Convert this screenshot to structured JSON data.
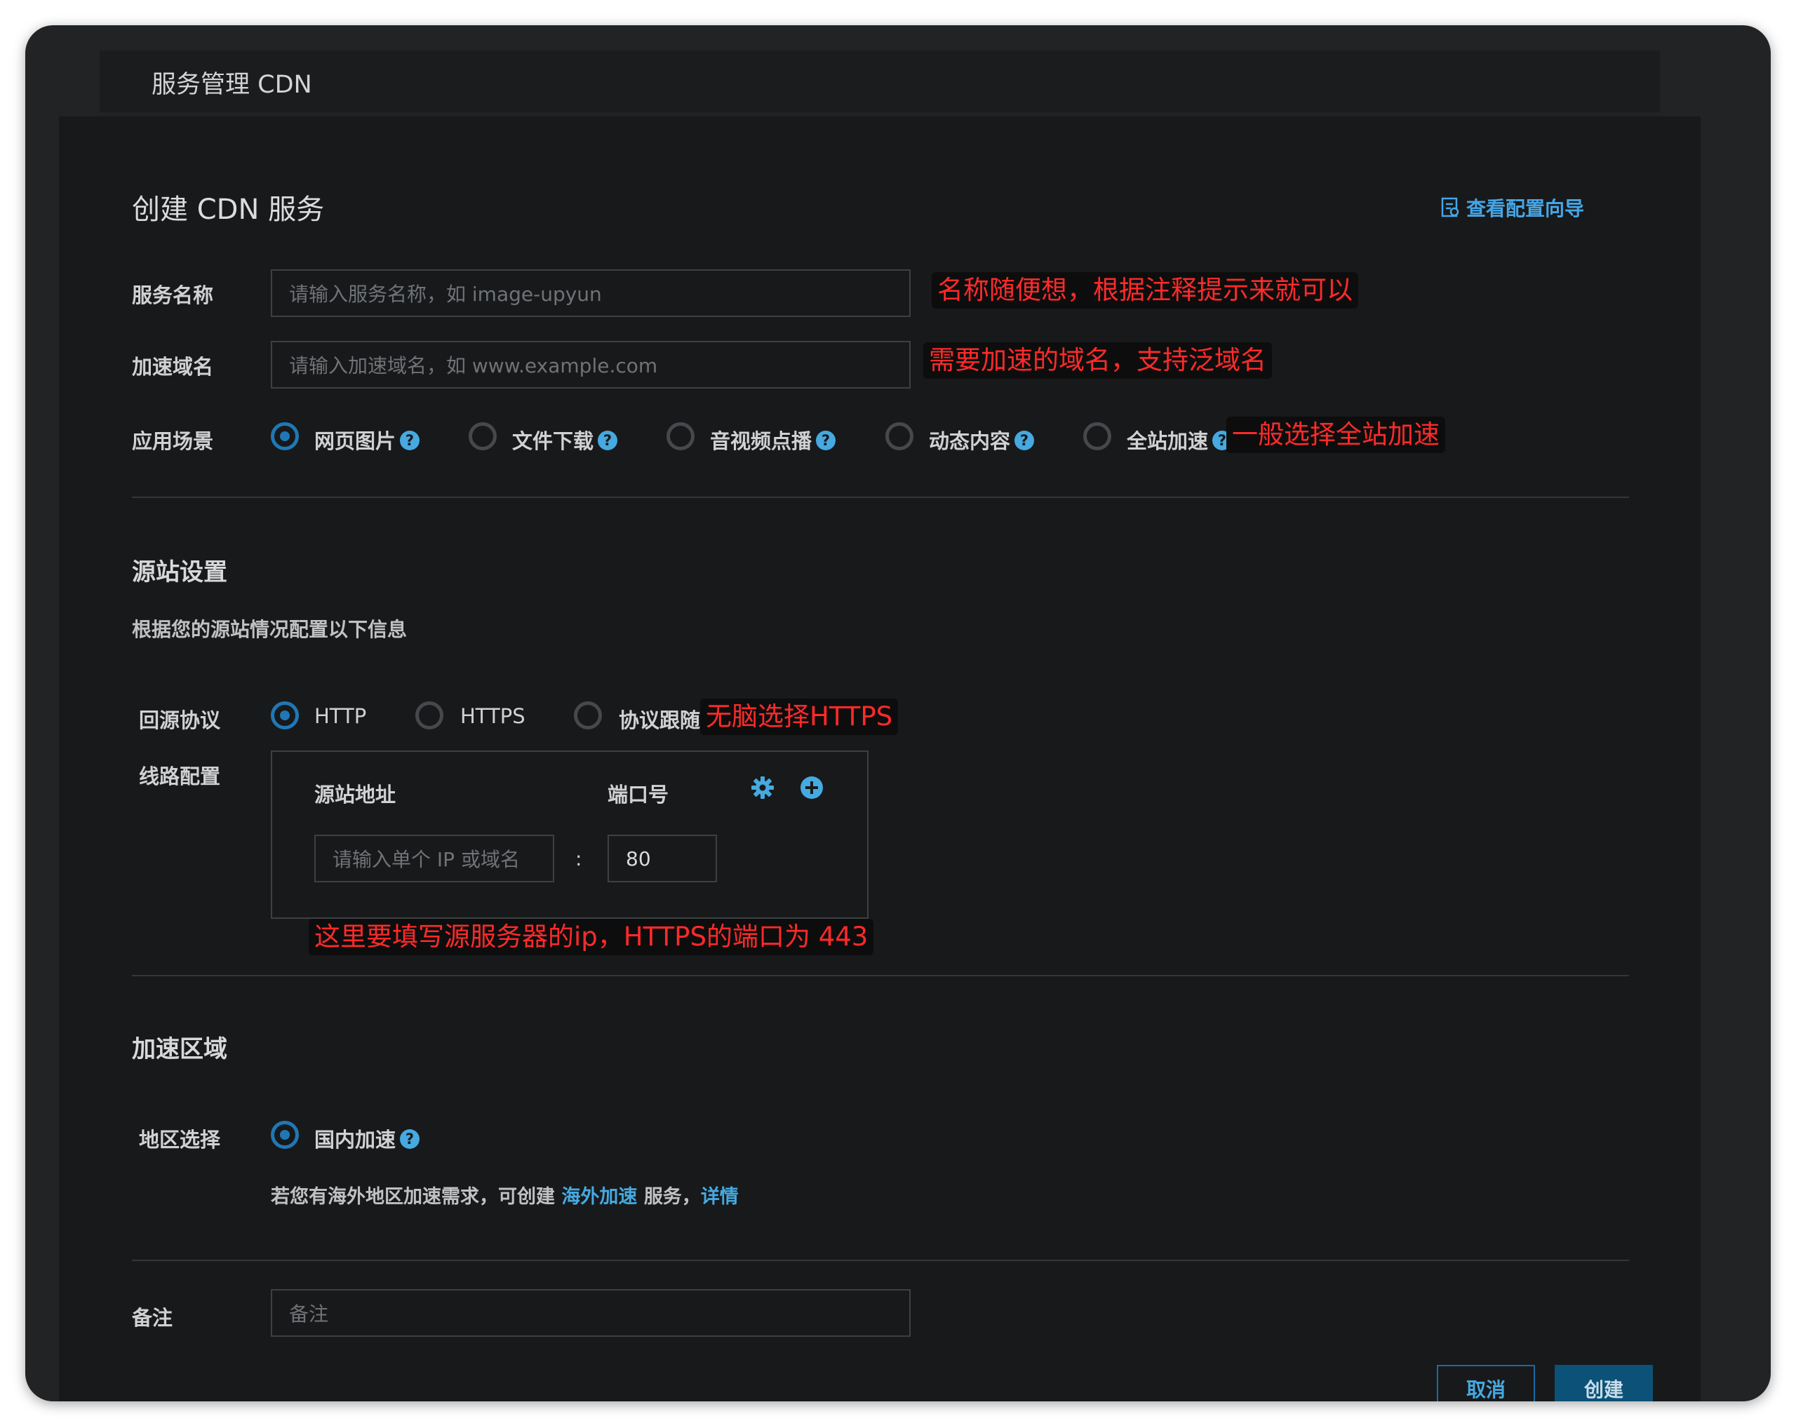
{
  "window": {
    "title": "服务管理 CDN"
  },
  "page": {
    "title": "创建 CDN 服务",
    "guide_link": "查看配置向导"
  },
  "basic": {
    "service_name": {
      "label": "服务名称",
      "placeholder": "请输入服务名称，如 image-upyun"
    },
    "domain": {
      "label": "加速域名",
      "placeholder": "请输入加速域名，如 www.example.com"
    },
    "scenario": {
      "label": "应用场景",
      "options": [
        "网页图片",
        "文件下载",
        "音视频点播",
        "动态内容",
        "全站加速"
      ],
      "selected": "网页图片"
    }
  },
  "origin": {
    "title": "源站设置",
    "desc": "根据您的源站情况配置以下信息",
    "protocol": {
      "label": "回源协议",
      "options": [
        "HTTP",
        "HTTPS",
        "协议跟随"
      ],
      "selected": "HTTP"
    },
    "route": {
      "label": "线路配置",
      "address_header": "源站地址",
      "port_header": "端口号",
      "address_placeholder": "请输入单个 IP 或域名",
      "separator": ":",
      "port_value": "80"
    }
  },
  "region": {
    "title": "加速区域",
    "label": "地区选择",
    "option": "国内加速",
    "hint_prefix": "若您有海外地区加速需求，可创建",
    "hint_link": "海外加速",
    "hint_middle": "服务，",
    "hint_detail": "详情"
  },
  "remark": {
    "label": "备注",
    "placeholder": "备注"
  },
  "buttons": {
    "cancel": "取消",
    "create": "创建"
  },
  "annotations": {
    "name": "名称随便想，根据注释提示来就可以",
    "domain": "需要加速的域名，支持泛域名",
    "scenario": "一般选择全站加速",
    "protocol": "无脑选择HTTPS",
    "origin": "这里要填写源服务器的ip，HTTPS的端口为 443"
  },
  "colors": {
    "accent": "#46a9e0",
    "annotation": "#ff2a2a",
    "panel": "#18191b"
  }
}
